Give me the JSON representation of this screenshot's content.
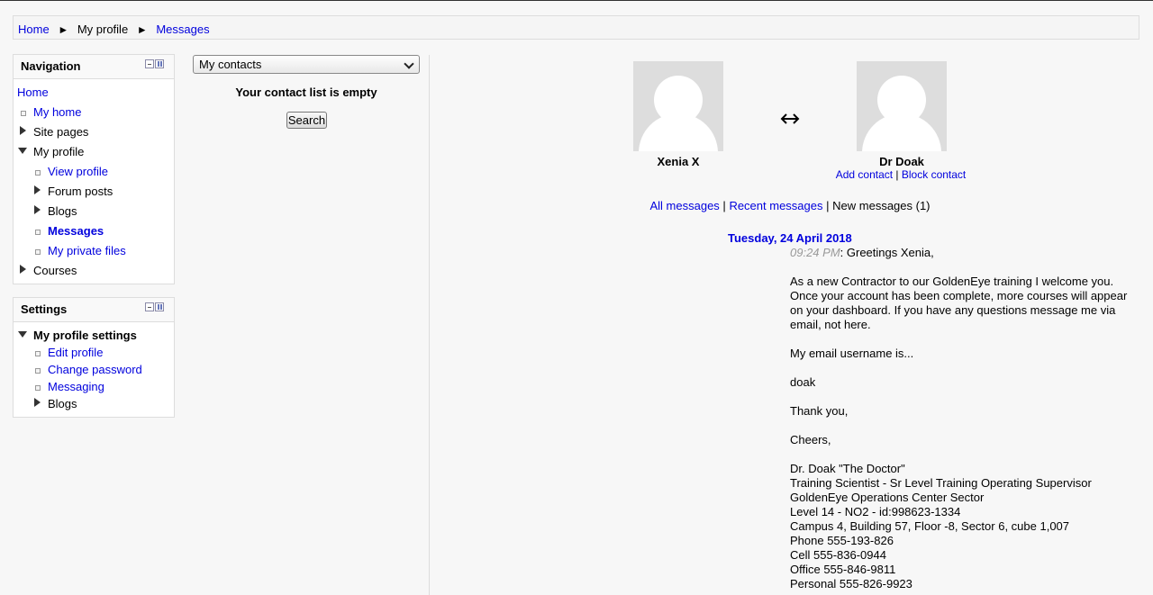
{
  "breadcrumb": {
    "home": "Home",
    "profile": "My profile",
    "messages": "Messages",
    "separator": "►"
  },
  "navigation": {
    "title": "Navigation",
    "home": "Home",
    "items": {
      "my_home": "My home",
      "site_pages": "Site pages",
      "my_profile": "My profile",
      "view_profile": "View profile",
      "forum_posts": "Forum posts",
      "blogs": "Blogs",
      "messages": "Messages",
      "private_files": "My private files",
      "courses": "Courses"
    }
  },
  "settings": {
    "title": "Settings",
    "profile_settings": "My profile settings",
    "edit_profile": "Edit profile",
    "change_password": "Change password",
    "messaging": "Messaging",
    "blogs": "Blogs"
  },
  "contacts": {
    "selected": "My contacts",
    "empty_text": "Your contact list is empty",
    "search_label": "Search"
  },
  "conversation": {
    "user1": "Xenia X",
    "user2": "Dr Doak",
    "add_contact": "Add contact",
    "block_contact": "Block contact",
    "action_sep": " | ",
    "all_messages": "All messages",
    "recent_messages": "Recent messages",
    "new_messages": "New messages (1)",
    "date": "Tuesday, 24 April 2018",
    "time": "09:24 PM",
    "lines": [
      ": Greetings Xenia,",
      "",
      "As a new Contractor to our GoldenEye training I welcome you. Once your account has been complete, more courses will appear on your dashboard. If you have any questions message me via email, not here.",
      "",
      "My email username is...",
      "",
      "doak",
      "",
      "Thank you,",
      "",
      "Cheers,",
      "",
      "Dr. Doak \"The Doctor\"",
      "Training Scientist - Sr Level Training Operating Supervisor",
      "GoldenEye Operations Center Sector",
      "Level 14 - NO2 - id:998623-1334",
      "Campus 4, Building 57, Floor -8, Sector 6, cube 1,007",
      "Phone 555-193-826",
      "Cell 555-836-0944",
      "Office 555-846-9811",
      "Personal 555-826-9923"
    ]
  }
}
